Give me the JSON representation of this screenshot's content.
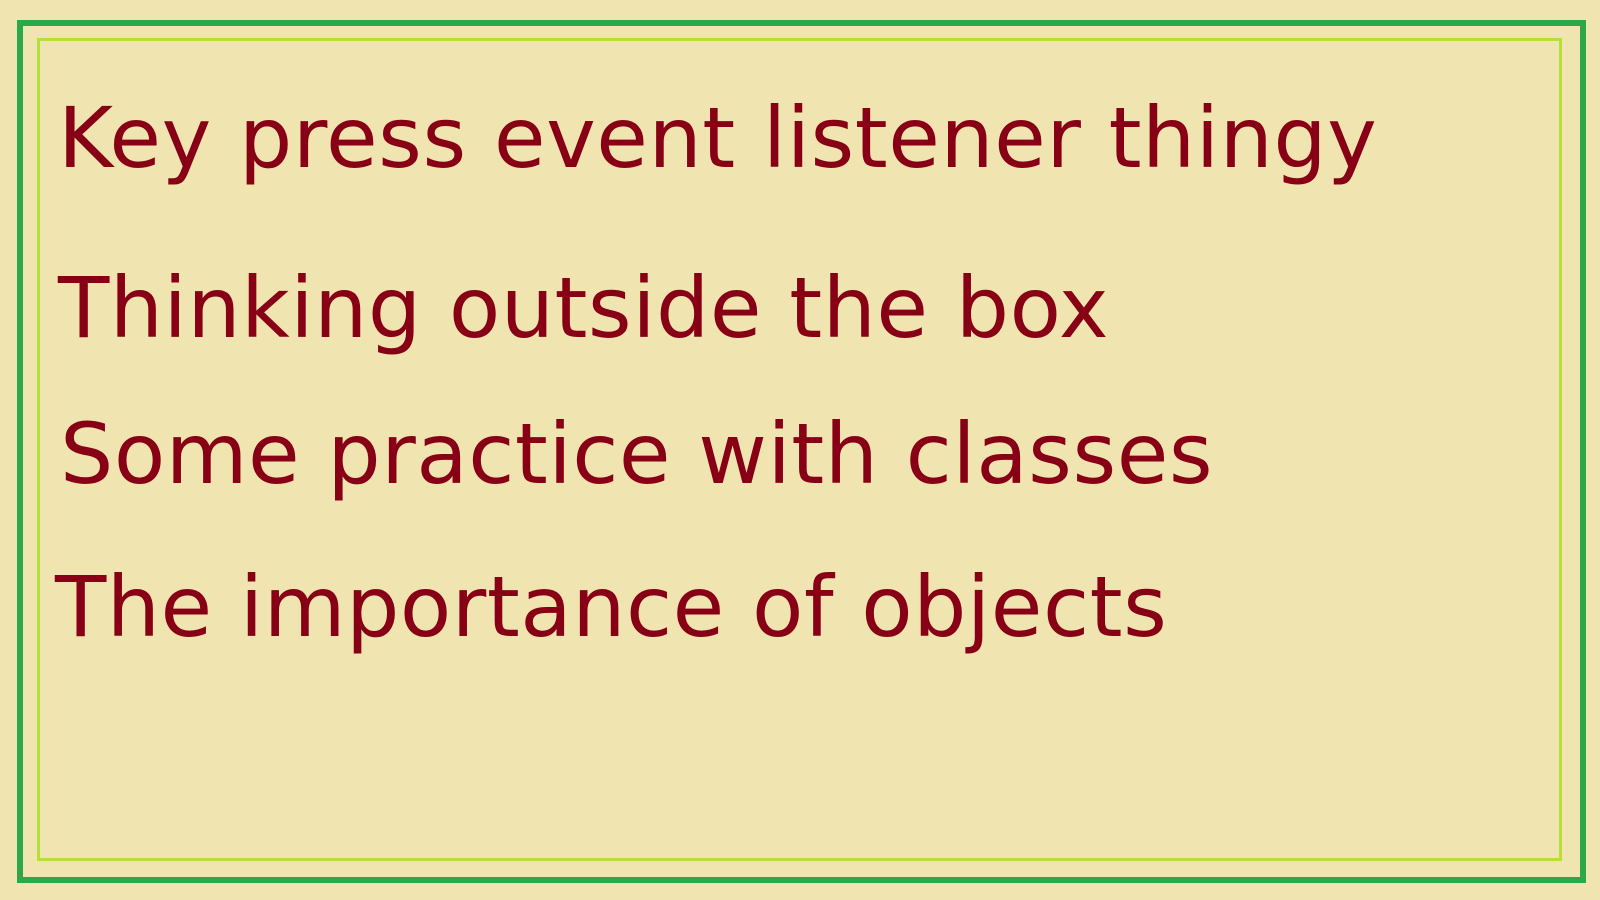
{
  "colors": {
    "background": "#f0e4b0",
    "outer_border": "#2aa84a",
    "inner_border": "#b4e03a",
    "text": "#880015"
  },
  "lines": [
    "Key press event listener thingy",
    "Thinking outside the box",
    "Some practice with classes",
    "The importance of objects"
  ]
}
